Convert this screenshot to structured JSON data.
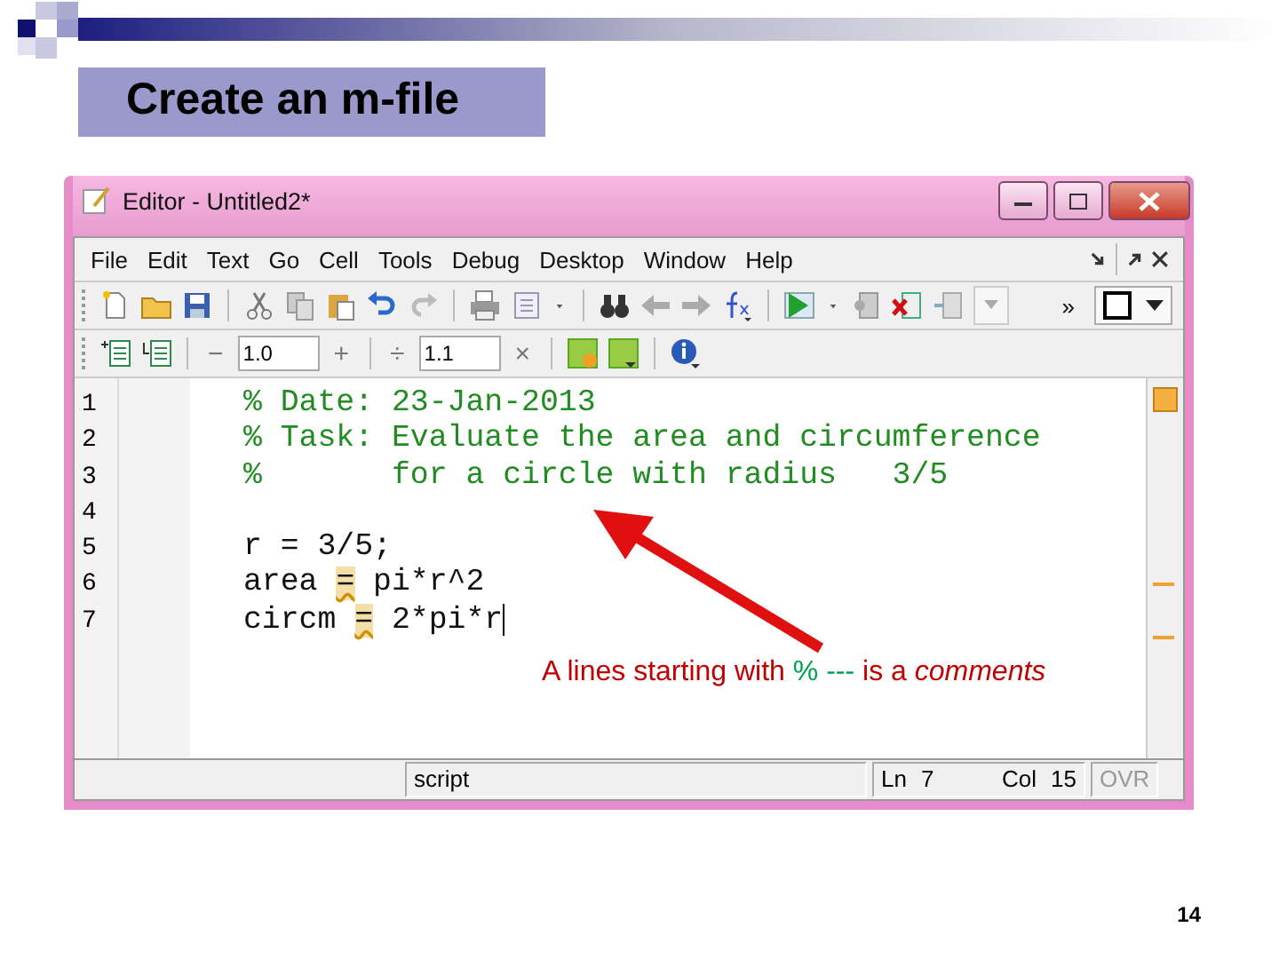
{
  "slide_title": "Create an m-file",
  "window": {
    "title": "Editor - Untitled2*"
  },
  "menu": [
    "File",
    "Edit",
    "Text",
    "Go",
    "Cell",
    "Tools",
    "Debug",
    "Desktop",
    "Window",
    "Help"
  ],
  "toolbar": {
    "overflow": "»"
  },
  "cell_toolbar": {
    "decrement": "−",
    "value_1": "1.0",
    "increment": "+",
    "divide": "÷",
    "value_2": "1.1",
    "multiply": "×"
  },
  "editor": {
    "lines": [
      {
        "number": "1",
        "kind": "comment",
        "cursor": false,
        "parts": [
          {
            "text": "% Date: 23-Jan-2013",
            "warning": false
          }
        ]
      },
      {
        "number": "2",
        "kind": "comment",
        "cursor": false,
        "parts": [
          {
            "text": "% Task: Evaluate the area and circumference",
            "warning": false
          }
        ]
      },
      {
        "number": "3",
        "kind": "comment",
        "cursor": false,
        "parts": [
          {
            "text": "%       for a circle with radius   3/5",
            "warning": false
          }
        ]
      },
      {
        "number": "4",
        "kind": "code",
        "cursor": false
      },
      {
        "number": "5",
        "kind": "code",
        "cursor": false,
        "parts": [
          {
            "text": "r = 3/5;",
            "warning": false
          }
        ]
      },
      {
        "number": "6",
        "kind": "code",
        "cursor": false,
        "parts": [
          {
            "text": "area ",
            "warning": false
          },
          {
            "text": "=",
            "warning": true
          },
          {
            "text": " pi*r^2",
            "warning": false
          }
        ]
      },
      {
        "number": "7",
        "kind": "code",
        "cursor": true,
        "parts": [
          {
            "text": "circm ",
            "warning": false
          },
          {
            "text": "=",
            "warning": true
          },
          {
            "text": " 2*pi*r",
            "warning": false
          }
        ]
      }
    ]
  },
  "annotation": {
    "parts": [
      {
        "text": "A lines starting with ",
        "kind": "note"
      },
      {
        "text": "%",
        "kind": "symbol"
      },
      {
        "text": " --- ",
        "kind": "symbol"
      },
      {
        "text": "is a *comments*",
        "kind": "note"
      }
    ]
  },
  "status_bar": {
    "mode": "script",
    "ln_label": "Ln",
    "ln": "7",
    "col_label": "Col",
    "col": "15",
    "ovr": {
      "text": "OVR",
      "on": false
    }
  },
  "page_number": "14"
}
